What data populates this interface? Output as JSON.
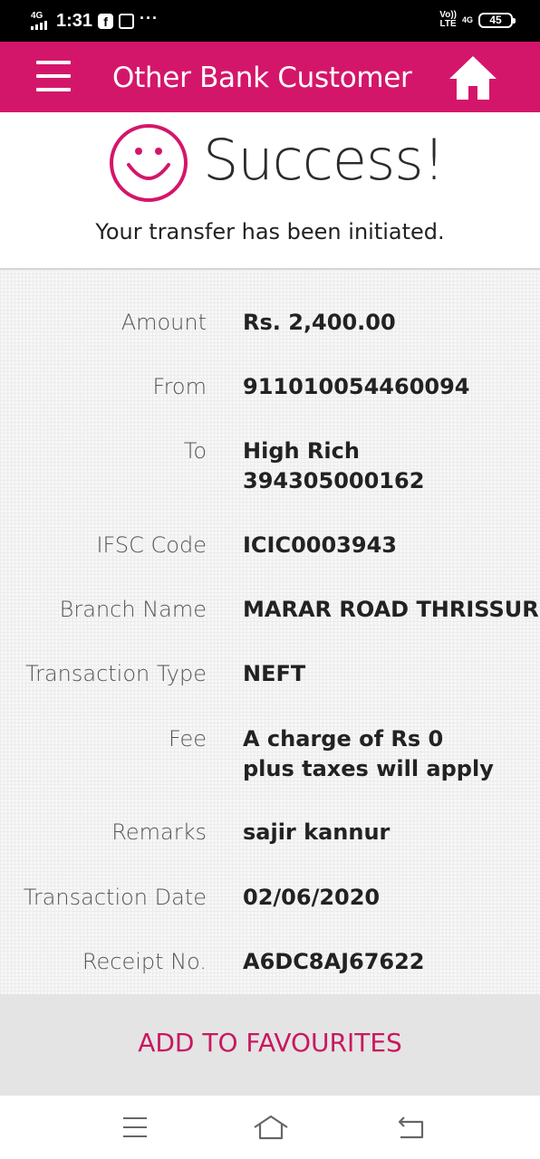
{
  "status_bar": {
    "network_small": "4G",
    "time": "1:31",
    "volte": "Vo))",
    "lte": "LTE",
    "net_right": "4G",
    "battery": "45"
  },
  "header": {
    "title": "Other Bank Customer",
    "menu_icon": "hamburger-menu-icon",
    "home_icon": "home-icon",
    "color": "#d4166a"
  },
  "success": {
    "icon": "smiley-icon",
    "title": "Success!",
    "message": "Your transfer has been initiated."
  },
  "details": [
    {
      "label": "Amount",
      "value": "Rs. 2,400.00"
    },
    {
      "label": "From",
      "value": "911010054460094"
    },
    {
      "label": "To",
      "value": "High Rich\n394305000162"
    },
    {
      "label": "IFSC Code",
      "value": "ICIC0003943"
    },
    {
      "label": "Branch Name",
      "value": "MARAR ROAD THRISSUR"
    },
    {
      "label": "Transaction Type",
      "value": "NEFT"
    },
    {
      "label": "Fee",
      "value": "A charge of Rs 0 plus taxes will apply"
    },
    {
      "label": "Remarks",
      "value": "sajir kannur"
    },
    {
      "label": "Transaction Date",
      "value": "02/06/2020"
    },
    {
      "label": "Receipt No.",
      "value": "A6DC8AJ67622"
    }
  ],
  "actions": {
    "add_to_favourites": "ADD TO FAVOURITES",
    "accent": "#c9175f"
  },
  "nav_bar": {
    "menu_icon": "recent-apps-icon",
    "home_icon": "nav-home-icon",
    "back_icon": "back-icon"
  }
}
